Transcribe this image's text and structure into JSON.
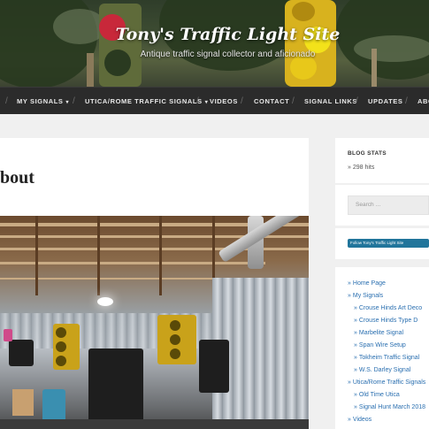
{
  "header": {
    "site_title": "Tony's Traffic Light Site",
    "tagline": "Antique traffic signal collector and aficionado"
  },
  "nav": {
    "items": [
      {
        "label": "MY SIGNALS",
        "has_dropdown": true
      },
      {
        "label": "UTICA/ROME TRAFFIC SIGNALS",
        "has_dropdown": true
      },
      {
        "label": "VIDEOS",
        "has_dropdown": false
      },
      {
        "label": "CONTACT",
        "has_dropdown": false
      },
      {
        "label": "SIGNAL LINKS",
        "has_dropdown": false
      },
      {
        "label": "UPDATES",
        "has_dropdown": false
      },
      {
        "label": "ABO",
        "has_dropdown": false
      }
    ],
    "separator": "/",
    "caret": "▾"
  },
  "main": {
    "page_title": "bout"
  },
  "sidebar": {
    "blog_stats": {
      "title": "BLOG STATS",
      "hits": "298 hits"
    },
    "search": {
      "placeholder": "Search …"
    },
    "follow": {
      "label": "Follow Tony's Traffic Light Site"
    },
    "menu": {
      "bullet": "»",
      "items": [
        {
          "label": "Home Page",
          "level": 0
        },
        {
          "label": "My Signals",
          "level": 0
        },
        {
          "label": "Crouse Hinds Art Deco",
          "level": 1
        },
        {
          "label": "Crouse Hinds Type D",
          "level": 1
        },
        {
          "label": "Marbelite Signal",
          "level": 1
        },
        {
          "label": "Span Wire Setup",
          "level": 1
        },
        {
          "label": "Tokheim Traffic Signal",
          "level": 1
        },
        {
          "label": "W.S. Darley Signal",
          "level": 1
        },
        {
          "label": "Utica/Rome Traffic Signals",
          "level": 0
        },
        {
          "label": "Old Time Utica",
          "level": 1
        },
        {
          "label": "Signal Hunt March 2018",
          "level": 1
        },
        {
          "label": "Videos",
          "level": 0
        }
      ]
    }
  },
  "colors": {
    "nav_bg": "#2b2b2b",
    "link": "#2a6fb0",
    "follow_button": "#21759b",
    "page_bg": "#f0f0f0"
  }
}
